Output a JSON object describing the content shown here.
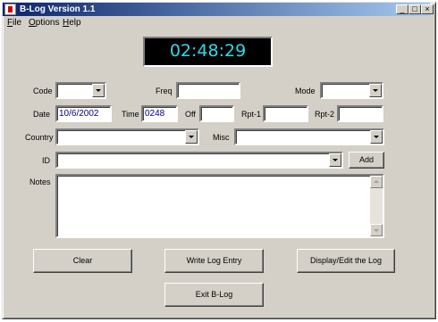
{
  "window": {
    "title": "B-Log Version 1.1"
  },
  "titlebar_buttons": {
    "minimize": "_",
    "maximize": "□",
    "close": "×"
  },
  "menu": {
    "file": "File",
    "options": "Options",
    "help": "Help"
  },
  "clock": {
    "time": "02:48:29"
  },
  "form": {
    "code_label": "Code",
    "freq_label": "Freq",
    "mode_label": "Mode",
    "date_label": "Date",
    "date_value": "10/6/2002",
    "time_label": "Time",
    "time_value": "0248",
    "off_label": "Off",
    "rpt1_label": "Rpt-1",
    "rpt2_label": "Rpt-2",
    "country_label": "Country",
    "misc_label": "Misc",
    "id_label": "ID",
    "add_label": "Add",
    "notes_label": "Notes"
  },
  "buttons": {
    "clear": "Clear",
    "write": "Write Log Entry",
    "display": "Display/Edit the Log",
    "exit": "Exit B-Log"
  }
}
